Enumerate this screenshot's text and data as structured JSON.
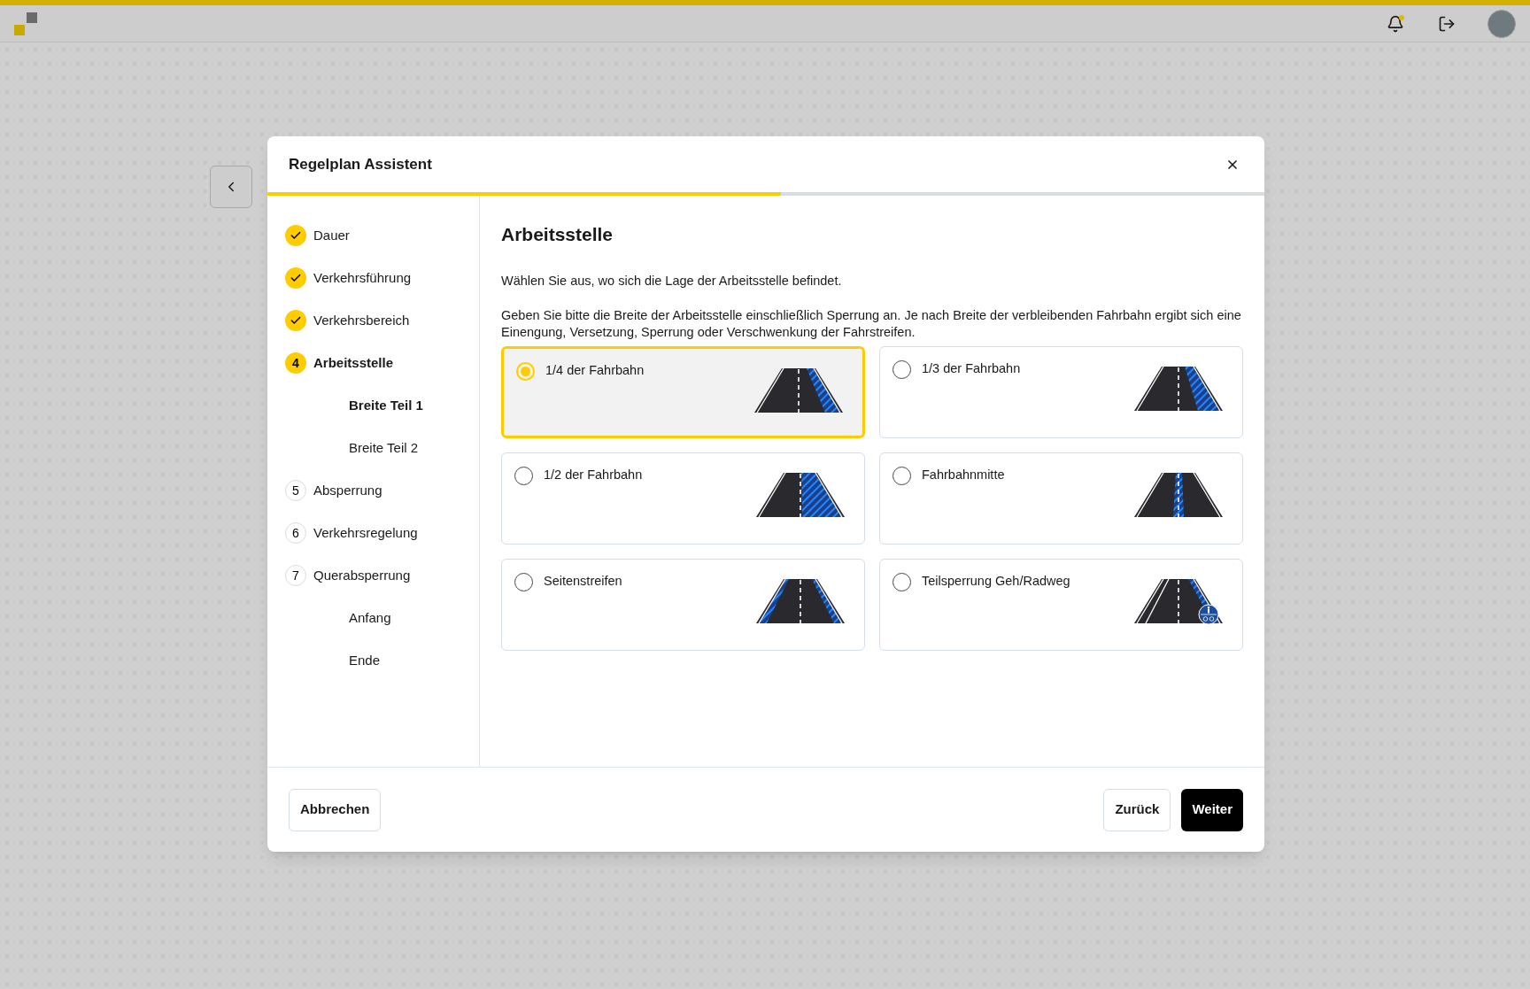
{
  "dialog": {
    "title": "Regelplan Assistent",
    "progress": {
      "level": 0.515
    }
  },
  "steps": [
    {
      "label": "Dauer",
      "done": true,
      "current": false
    },
    {
      "label": "Verkehrsführung",
      "done": true,
      "current": false
    },
    {
      "label": "Verkehrsbereich",
      "done": true,
      "current": false
    },
    {
      "marker": "4",
      "label": "Arbeitsstelle",
      "done": false,
      "current": true,
      "children": [
        {
          "label": "Breite Teil 1",
          "selected": true
        },
        {
          "label": "Breite Teil 2",
          "selected": false
        }
      ]
    },
    {
      "marker": "5",
      "label": "Absperrung",
      "done": false,
      "current": false
    },
    {
      "marker": "6",
      "label": "Verkehrsregelung",
      "done": false,
      "current": false
    },
    {
      "marker": "7",
      "label": "Querabsperrung",
      "done": false,
      "current": false,
      "children": [
        {
          "label": "Anfang",
          "selected": false
        },
        {
          "label": "Ende",
          "selected": false
        }
      ]
    }
  ],
  "content": {
    "heading": "Arbeitsstelle",
    "intro": "Wählen Sie aus, wo sich die Lage der Arbeitsstelle befindet.",
    "hint": "Geben Sie bitte die Breite der Arbeitsstelle einschließlich Sperrung an. Je nach Breite der verbleibenden Fahrbahn ergibt sich eine Einengung, Versetzung, Sperrung oder Verschwenkung der Fahrstreifen.",
    "options": [
      {
        "label": "1/4 der Fahrbahn",
        "kind": "quarter",
        "selected": true
      },
      {
        "label": "1/3 der Fahrbahn",
        "kind": "third",
        "selected": false
      },
      {
        "label": "1/2 der Fahrbahn",
        "kind": "half",
        "selected": false
      },
      {
        "label": "Fahrbahnmitte",
        "kind": "center",
        "selected": false
      },
      {
        "label": "Seitenstreifen",
        "kind": "shoulder",
        "selected": false
      },
      {
        "label": "Teilsperrung Geh/Radweg",
        "kind": "sidewalk",
        "selected": false
      }
    ]
  },
  "footer": {
    "cancel": "Abbrechen",
    "back": "Zurück",
    "next": "Weiter"
  }
}
